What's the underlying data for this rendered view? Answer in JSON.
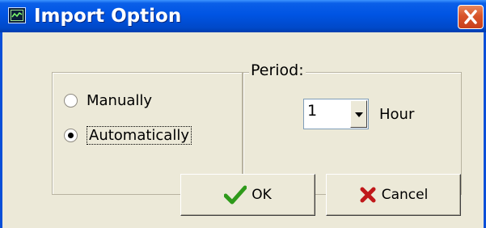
{
  "window": {
    "title": "Import Option",
    "app_icon": "chart-icon",
    "close_icon": "close-icon"
  },
  "mode": {
    "options": [
      {
        "label": "Manually",
        "checked": false
      },
      {
        "label": "Automatically",
        "checked": true
      }
    ]
  },
  "period": {
    "legend": "Period:",
    "value": "1",
    "unit": "Hour"
  },
  "buttons": {
    "ok": {
      "label": "OK",
      "icon": "checkmark-icon",
      "icon_color": "#2e9a1a"
    },
    "cancel": {
      "label": "Cancel",
      "icon": "x-icon",
      "icon_color": "#c0181a"
    }
  }
}
